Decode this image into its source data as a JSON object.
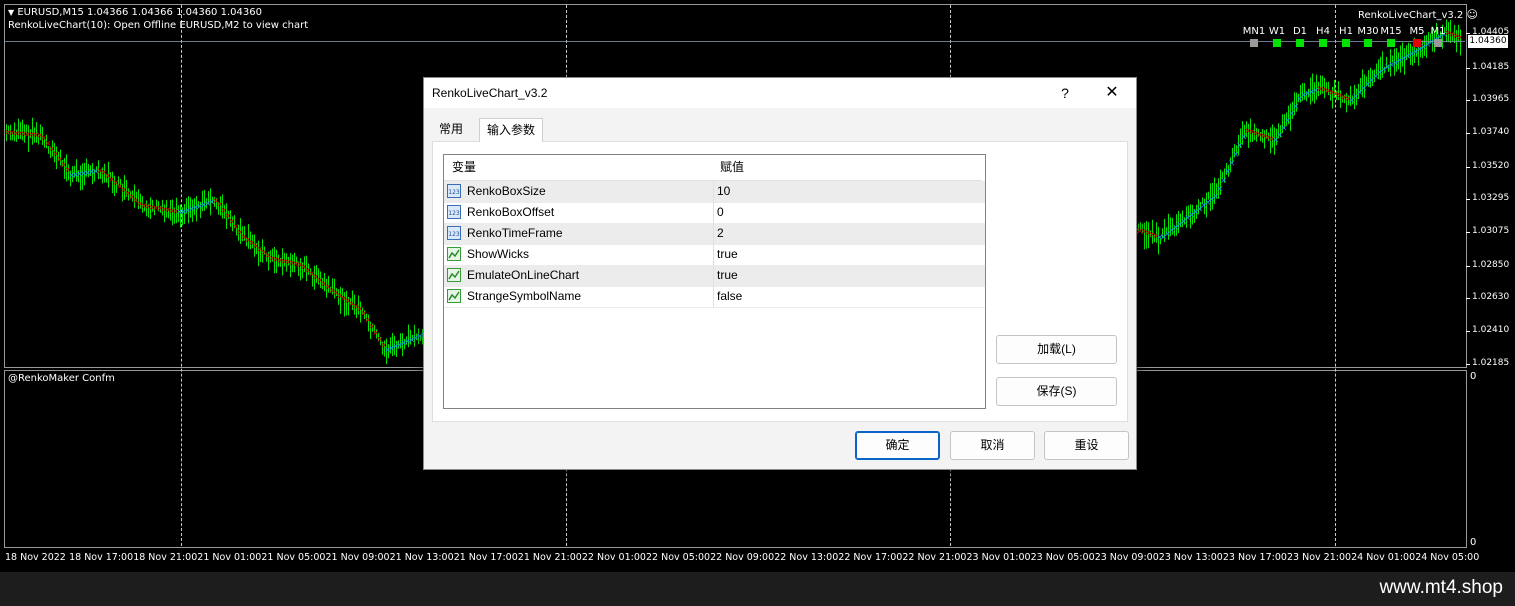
{
  "chart": {
    "symbol_line": "EURUSD,M15  1.04366 1.04366 1.04360 1.04360",
    "indicator_line": "RenkoLiveChart(10): Open Offline EURUSD,M2 to view chart",
    "ea_name": "RenkoLiveChart_v3.2",
    "smiley": "☺",
    "current_price": "1.04360",
    "price_axis": [
      "1.04405",
      "1.04185",
      "1.03965",
      "1.03740",
      "1.03520",
      "1.03295",
      "1.03075",
      "1.02850",
      "1.02630",
      "1.02410",
      "1.02185"
    ],
    "subwindow_label": "@RenkoMaker Confm",
    "subwindow_axis_top": "0",
    "subwindow_axis_bottom": "0",
    "timeframes": [
      {
        "label": "MN1",
        "color": "#9a9a9a"
      },
      {
        "label": "W1",
        "color": "#00e400"
      },
      {
        "label": "D1",
        "color": "#00e400"
      },
      {
        "label": "H4",
        "color": "#00e400"
      },
      {
        "label": "H1",
        "color": "#00e400"
      },
      {
        "label": "M30",
        "color": "#00e400"
      },
      {
        "label": "M15",
        "color": "#00e400"
      },
      {
        "label": "M5",
        "color": "#e00000"
      },
      {
        "label": "M1",
        "color": "#9a9a9a"
      }
    ],
    "date_axis": [
      "18 Nov 2022",
      "18 Nov 17:00",
      "18 Nov 21:00",
      "21 Nov 01:00",
      "21 Nov 05:00",
      "21 Nov 09:00",
      "21 Nov 13:00",
      "21 Nov 17:00",
      "21 Nov 21:00",
      "22 Nov 01:00",
      "22 Nov 05:00",
      "22 Nov 09:00",
      "22 Nov 13:00",
      "22 Nov 17:00",
      "22 Nov 21:00",
      "23 Nov 01:00",
      "23 Nov 05:00",
      "23 Nov 09:00",
      "23 Nov 13:00",
      "23 Nov 17:00",
      "23 Nov 21:00",
      "24 Nov 01:00",
      "24 Nov 05:00"
    ],
    "colors": {
      "bull_candle": "#00e400",
      "renko_up": "#1e90ff",
      "renko_down": "#e00000"
    }
  },
  "dialog": {
    "title": "RenkoLiveChart_v3.2",
    "help": "?",
    "close": "✕",
    "tabs": [
      "常用",
      "输入参数"
    ],
    "table": {
      "headers": [
        "变量",
        "赋值"
      ],
      "rows": [
        {
          "name": "RenkoBoxSize",
          "value": "10",
          "icon": "int-icon"
        },
        {
          "name": "RenkoBoxOffset",
          "value": "0",
          "icon": "int-icon"
        },
        {
          "name": "RenkoTimeFrame",
          "value": "2",
          "icon": "int-icon"
        },
        {
          "name": "ShowWicks",
          "value": "true",
          "icon": "bool-icon"
        },
        {
          "name": "EmulateOnLineChart",
          "value": "true",
          "icon": "bool-icon"
        },
        {
          "name": "StrangeSymbolName",
          "value": "false",
          "icon": "bool-icon"
        }
      ]
    },
    "buttons": {
      "load": "加载(L)",
      "save": "保存(S)",
      "ok": "确定",
      "cancel": "取消",
      "reset": "重设"
    }
  },
  "footer": {
    "watermark": "www.mt4.shop"
  }
}
